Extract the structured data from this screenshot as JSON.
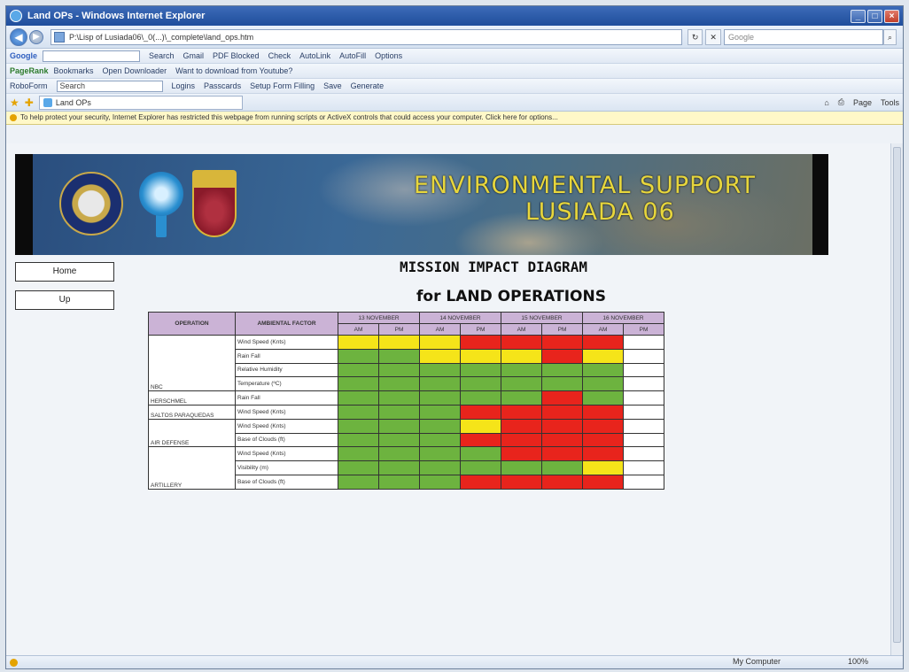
{
  "window": {
    "title": "Land OPs - Windows Internet Explorer"
  },
  "address": {
    "url": "P:\\Lisp of Lusiada06\\_0(...)\\_complete\\land_ops.htm",
    "search_placeholder": "Google"
  },
  "toolbars": {
    "google": {
      "brand": "Google",
      "items": [
        "Search",
        "Gmail",
        "PDF Blocked",
        "Check",
        "AutoLink",
        "AutoFill",
        "Options"
      ]
    },
    "pagerank": {
      "brand": "PageRank",
      "items": [
        "Bookmarks",
        "Open Downloader",
        "Want to download from Youtube?"
      ]
    },
    "roboform": {
      "brand": "RoboForm",
      "search_placeholder": "Search",
      "items": [
        "Logins",
        "Passcards",
        "Setup Form Filling",
        "Save",
        "Generate"
      ]
    }
  },
  "tab": {
    "label": "Land OPs"
  },
  "commands": [
    "Page",
    "Tools"
  ],
  "infobar": {
    "text": "To help protect your security, Internet Explorer has restricted this webpage from running scripts or ActiveX controls that could access your computer. Click here for options..."
  },
  "banner": {
    "line1": "ENVIRONMENTAL SUPPORT",
    "line2": "LUSIADA 06"
  },
  "nav": {
    "home": "Home",
    "up": "Up"
  },
  "heading": {
    "title": "MISSION IMPACT DIAGRAM",
    "subtitle": "for LAND OPERATIONS"
  },
  "table": {
    "col_operation": "OPERATION",
    "col_factor": "AMBIENTAL FACTOR",
    "dates": [
      "13 NOVEMBER",
      "14 NOVEMBER",
      "15 NOVEMBER",
      "16 NOVEMBER"
    ],
    "periods": [
      "AM",
      "PM",
      "AM",
      "PM",
      "AM",
      "PM",
      "AM",
      "PM"
    ],
    "colors": {
      "G": "#6db33f",
      "Y": "#f5e419",
      "R": "#e8241c",
      "W": "#ffffff"
    },
    "rows": [
      {
        "operation": "NBC",
        "span": 4,
        "factor": "Wind Speed (Knts)",
        "cells": "YYYRRRRW"
      },
      {
        "operation": null,
        "factor": "Rain Fall",
        "cells": "GGYYYRYW"
      },
      {
        "operation": null,
        "factor": "Relative Humidity",
        "cells": "GGGGGGGW"
      },
      {
        "operation": null,
        "factor": "Temperature (ºC)",
        "cells": "GGGGGGGW"
      },
      {
        "operation": "HERSCHMEL",
        "span": 1,
        "factor": "Rain Fall",
        "cells": "GGGGGRGW"
      },
      {
        "operation": "SALTOS PARAQUEDAS",
        "span": 1,
        "factor": "Wind Speed (Knts)",
        "cells": "GGGRRRRW"
      },
      {
        "operation": "AIR DEFENSE",
        "span": 2,
        "factor": "Wind Speed (Knts)",
        "cells": "GGGYRRRW"
      },
      {
        "operation": null,
        "factor": "Base of Clouds (ft)",
        "cells": "GGGRRRRW"
      },
      {
        "operation": "ARTILLERY",
        "span": 3,
        "factor": "Wind Speed (Knts)",
        "cells": "GGGGRRRW"
      },
      {
        "operation": null,
        "factor": "Visibility (m)",
        "cells": "GGGGGGYW"
      },
      {
        "operation": null,
        "factor": "Base of Clouds (ft)",
        "cells": "GGGRRRRW"
      }
    ]
  },
  "status": {
    "zone": "My Computer",
    "zoom": "100%"
  }
}
